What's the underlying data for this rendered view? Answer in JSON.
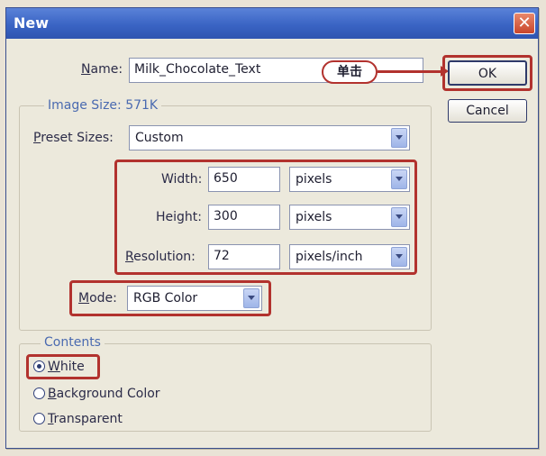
{
  "dialog": {
    "title": "New",
    "close_glyph": "✕"
  },
  "name_row": {
    "label": "Name:",
    "value": "Milk_Chocolate_Text"
  },
  "callout": {
    "text": "单击"
  },
  "buttons": {
    "ok": "OK",
    "cancel": "Cancel"
  },
  "image_size": {
    "legend": "Image Size: 571K"
  },
  "preset": {
    "label": "Preset Sizes:",
    "value": "Custom"
  },
  "width": {
    "label": "Width:",
    "value": "650",
    "unit": "pixels"
  },
  "height": {
    "label": "Height:",
    "value": "300",
    "unit": "pixels"
  },
  "resolution": {
    "label": "Resolution:",
    "value": "72",
    "unit": "pixels/inch"
  },
  "mode": {
    "label": "Mode:",
    "value": "RGB Color"
  },
  "contents": {
    "legend": "Contents",
    "options": [
      {
        "label": "White",
        "selected": true
      },
      {
        "label": "Background Color",
        "selected": false
      },
      {
        "label": "Transparent",
        "selected": false
      }
    ]
  },
  "colors": {
    "titlebar": "#3a64c4",
    "highlight": "#b2322e",
    "dialog_bg": "#ece9dc"
  },
  "icons": {
    "close": "close-icon",
    "dropdown": "chevron-down-icon",
    "radio": "radio-icon"
  }
}
